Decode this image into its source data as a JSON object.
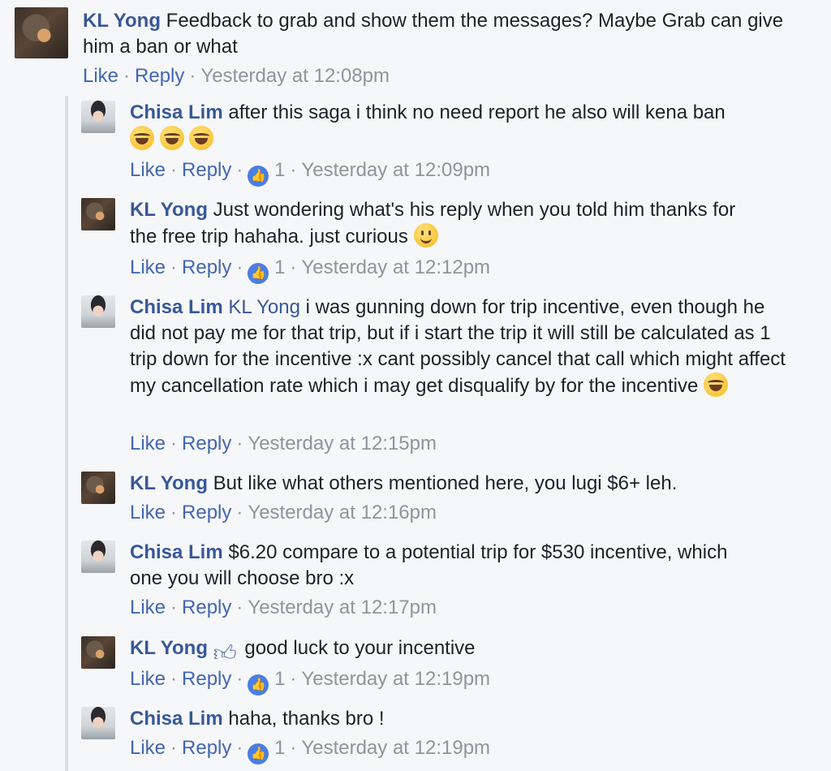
{
  "actions": {
    "like": "Like",
    "reply": "Reply",
    "separator": "·"
  },
  "comments": [
    {
      "author": "KL Yong",
      "text": "Feedback to grab and show them the messages? Maybe Grab can give him a ban or what",
      "likes": "",
      "time": "Yesterday at 12:08pm"
    },
    {
      "author": "Chisa Lim",
      "text": "after this saga i think no need report he also will kena ban",
      "emojis": [
        "laugh-cry-emoji",
        "laugh-cry-emoji",
        "laugh-cry-emoji"
      ],
      "likes": "1",
      "time": "Yesterday at 12:09pm"
    },
    {
      "author": "KL Yong",
      "text": "Just wondering what's his reply when you told him thanks for the free trip hahaha. just curious",
      "emojis": [
        "smile-emoji"
      ],
      "likes": "1",
      "time": "Yesterday at 12:12pm"
    },
    {
      "author": "Chisa Lim",
      "mention": "KL Yong",
      "text": "i was gunning down for trip incentive, even though he did not pay me for that trip, but if i start the trip it will still be calculated as 1 trip down for the incentive :x cant possibly cancel that call which might affect my cancellation rate which i may get disqualify by for the incentive",
      "emojis": [
        "laugh-cry-emoji"
      ],
      "likes": "",
      "time": "Yesterday at 12:15pm"
    },
    {
      "author": "KL Yong",
      "text": "But like what others mentioned here, you lugi $6+ leh.",
      "likes": "",
      "time": "Yesterday at 12:16pm"
    },
    {
      "author": "Chisa Lim",
      "text": "$6.20 compare to a potential trip for $530 incentive, which one you will choose bro :x",
      "likes": "",
      "time": "Yesterday at 12:17pm"
    },
    {
      "author": "KL Yong",
      "text": "good luck to your incentive",
      "emojis": [
        "thumbs-up-emoji"
      ],
      "likes": "1",
      "time": "Yesterday at 12:19pm"
    },
    {
      "author": "Chisa Lim",
      "text": "haha, thanks bro !",
      "likes": "1",
      "time": "Yesterday at 12:19pm"
    }
  ],
  "colors": {
    "name": "#385898",
    "link": "#4267b2",
    "meta": "#90949c",
    "background": "#f6f7f9",
    "like_badge": "#4a7ee4"
  }
}
